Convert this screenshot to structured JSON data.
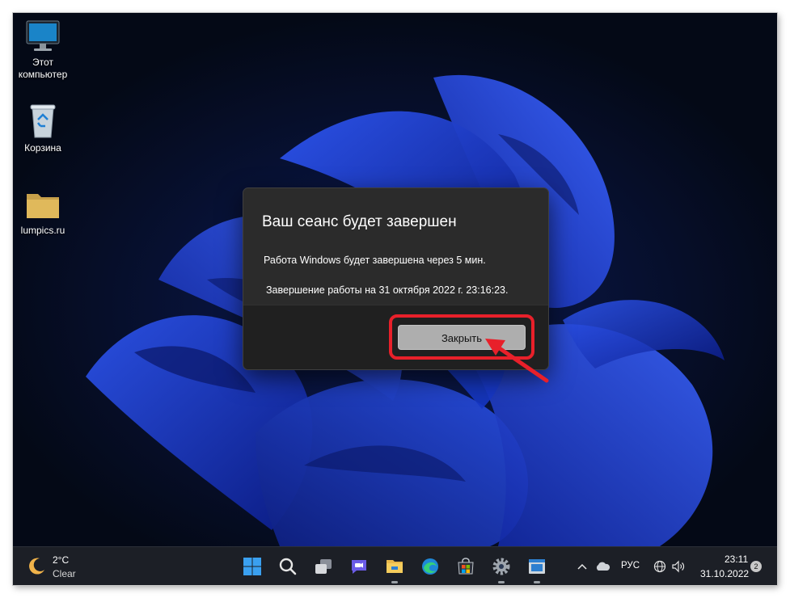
{
  "desktop": {
    "icons": [
      {
        "label": "Этот\nкомпьютер",
        "icon": "monitor-icon"
      },
      {
        "label": "Корзина",
        "icon": "recycle-bin-icon"
      },
      {
        "label": "lumpics.ru",
        "icon": "folder-icon"
      }
    ]
  },
  "dialog": {
    "title": "Ваш сеанс будет завершен",
    "message_line1": "Работа Windows будет завершена через 5 мин.",
    "message_line2": "Завершение работы на 31 октября 2022 г. 23:16:23.",
    "close_label": "Закрыть"
  },
  "annotation": {
    "color": "#e8202a"
  },
  "taskbar": {
    "weather": {
      "temp": "2°C",
      "condition": "Clear",
      "icon": "moon-icon"
    },
    "apps": [
      "start-icon",
      "search-icon",
      "task-view-icon",
      "chat-icon",
      "file-explorer-icon",
      "edge-icon",
      "store-icon",
      "settings-icon",
      "app-icon"
    ],
    "tray": {
      "language": "РУС",
      "time": "23:11",
      "date": "31.10.2022",
      "notification_count": "2"
    }
  },
  "colors": {
    "wallpaper_bg": "#050b1d",
    "wallpaper_bloom": "#1f3fd6",
    "dialog_bg": "#2b2b2b",
    "dialog_footer": "#202020",
    "taskbar_bg": "#1c1f26",
    "button_bg": "#aeaeae"
  }
}
